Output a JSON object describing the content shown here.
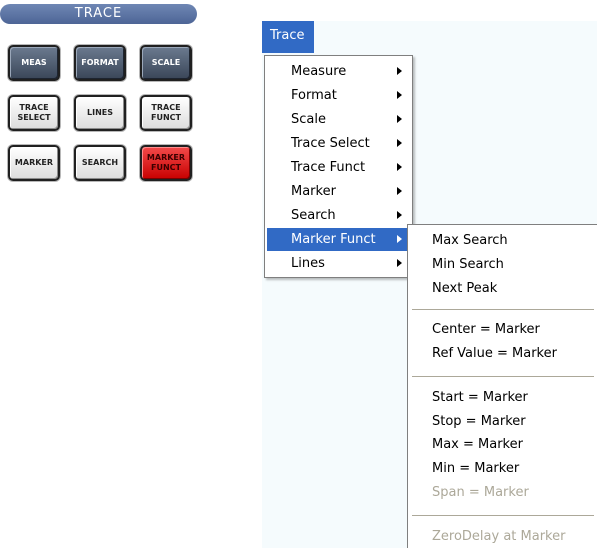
{
  "panel": {
    "title": "TRACE",
    "buttons": [
      {
        "label": "MEAS",
        "style": "dark"
      },
      {
        "label": "FORMAT",
        "style": "dark"
      },
      {
        "label": "SCALE",
        "style": "dark"
      },
      {
        "label": "TRACE\nSELECT",
        "style": "light"
      },
      {
        "label": "LINES",
        "style": "light"
      },
      {
        "label": "TRACE\nFUNCT",
        "style": "light"
      },
      {
        "label": "MARKER",
        "style": "light"
      },
      {
        "label": "SEARCH",
        "style": "light"
      },
      {
        "label": "MARKER\nFUNCT",
        "style": "red"
      }
    ]
  },
  "menubar": {
    "title": "Trace"
  },
  "menu": {
    "items": [
      {
        "label": "Measure"
      },
      {
        "label": "Format"
      },
      {
        "label": "Scale"
      },
      {
        "label": "Trace Select"
      },
      {
        "label": "Trace Funct"
      },
      {
        "label": "Marker"
      },
      {
        "label": "Search"
      },
      {
        "label": "Marker Funct",
        "selected": true
      },
      {
        "label": "Lines"
      }
    ]
  },
  "submenu": {
    "items": [
      {
        "label": "Max Search"
      },
      {
        "label": "Min Search"
      },
      {
        "label": "Next Peak"
      },
      {
        "label": "Center = Marker"
      },
      {
        "label": "Ref Value = Marker"
      },
      {
        "label": "Start = Marker"
      },
      {
        "label": "Stop = Marker"
      },
      {
        "label": "Max = Marker"
      },
      {
        "label": "Min = Marker"
      },
      {
        "label": "Span = Marker",
        "disabled": true
      },
      {
        "label": "ZeroDelay at Marker",
        "disabled": true
      }
    ]
  },
  "colors": {
    "menu_highlight": "#316ac5",
    "hardkey_active": "#e01f1f",
    "disabled_text": "#aca899"
  }
}
